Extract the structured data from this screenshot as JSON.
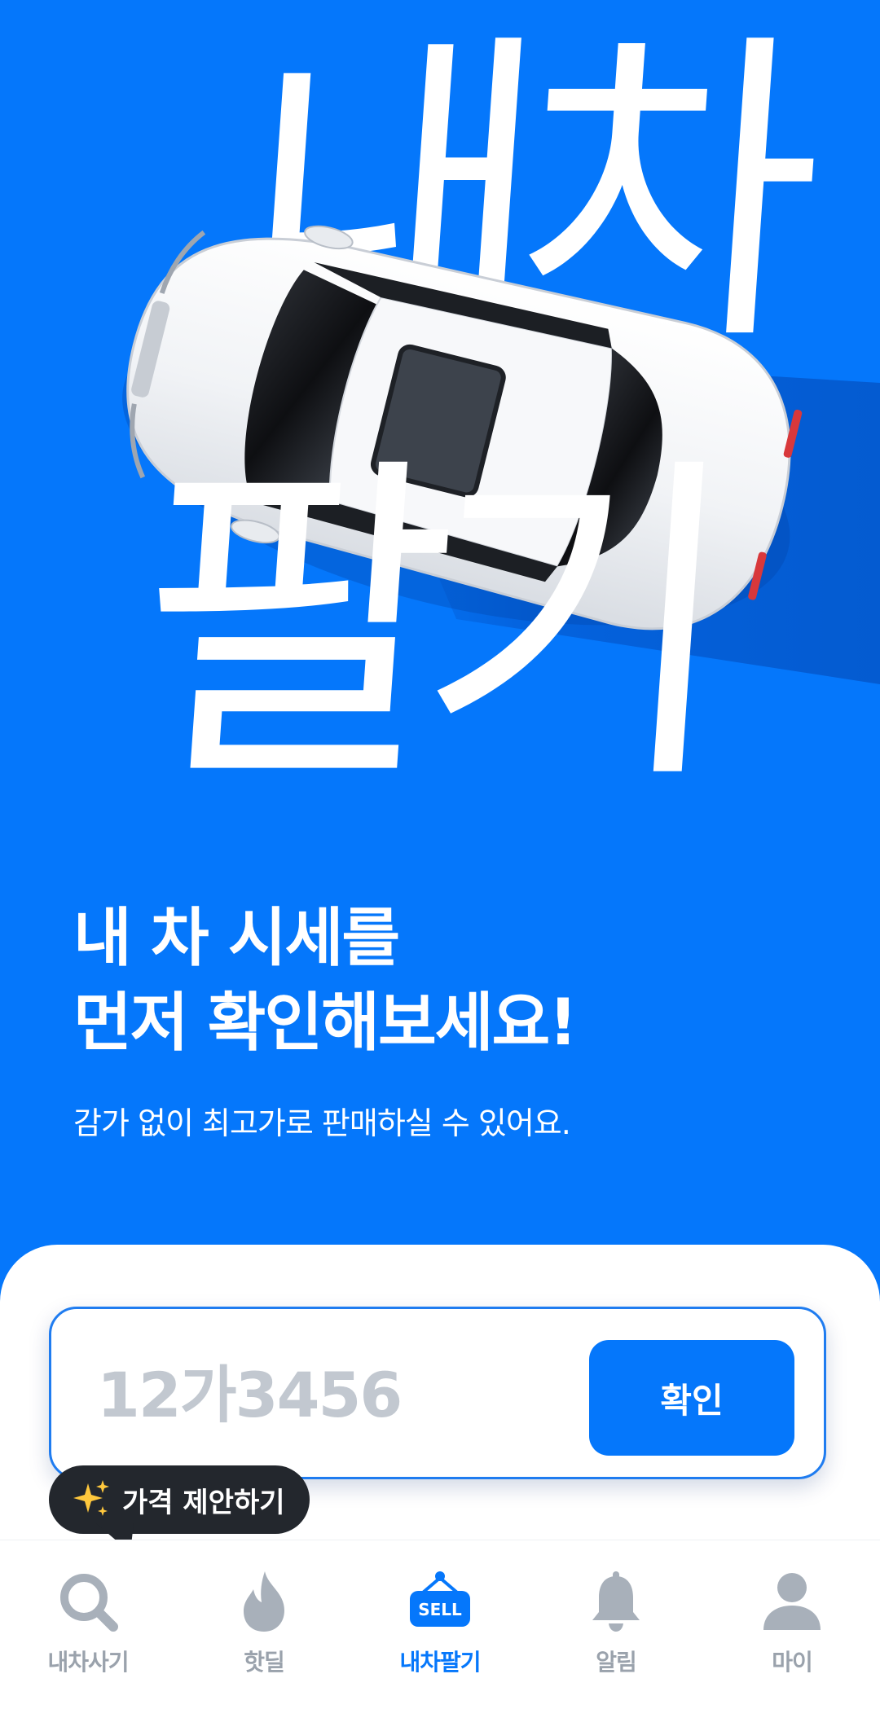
{
  "hero": {
    "big_word_top": "내차",
    "big_word_bottom": "팔기",
    "headline_line1": "내 차 시세를",
    "headline_line2": "먼저 확인해보세요!",
    "subline": "감가 없이 최고가로 판매하실 수 있어요.",
    "background_color": "#0577FB"
  },
  "plate_form": {
    "placeholder": "12가3456",
    "value": "",
    "confirm_label": "확인"
  },
  "tooltip": {
    "icon": "sparkles-icon",
    "label": "가격 제안하기"
  },
  "tabbar": {
    "items": [
      {
        "label": "내차사기",
        "icon": "search-icon",
        "active": false
      },
      {
        "label": "핫딜",
        "icon": "fire-icon",
        "active": false
      },
      {
        "label": "내차팔기",
        "icon": "sell-sign-icon",
        "active": true,
        "icon_text": "SELL"
      },
      {
        "label": "알림",
        "icon": "bell-icon",
        "active": false
      },
      {
        "label": "마이",
        "icon": "person-icon",
        "active": false
      }
    ],
    "active_color": "#0577FB",
    "inactive_color": "#9AA2AC"
  }
}
